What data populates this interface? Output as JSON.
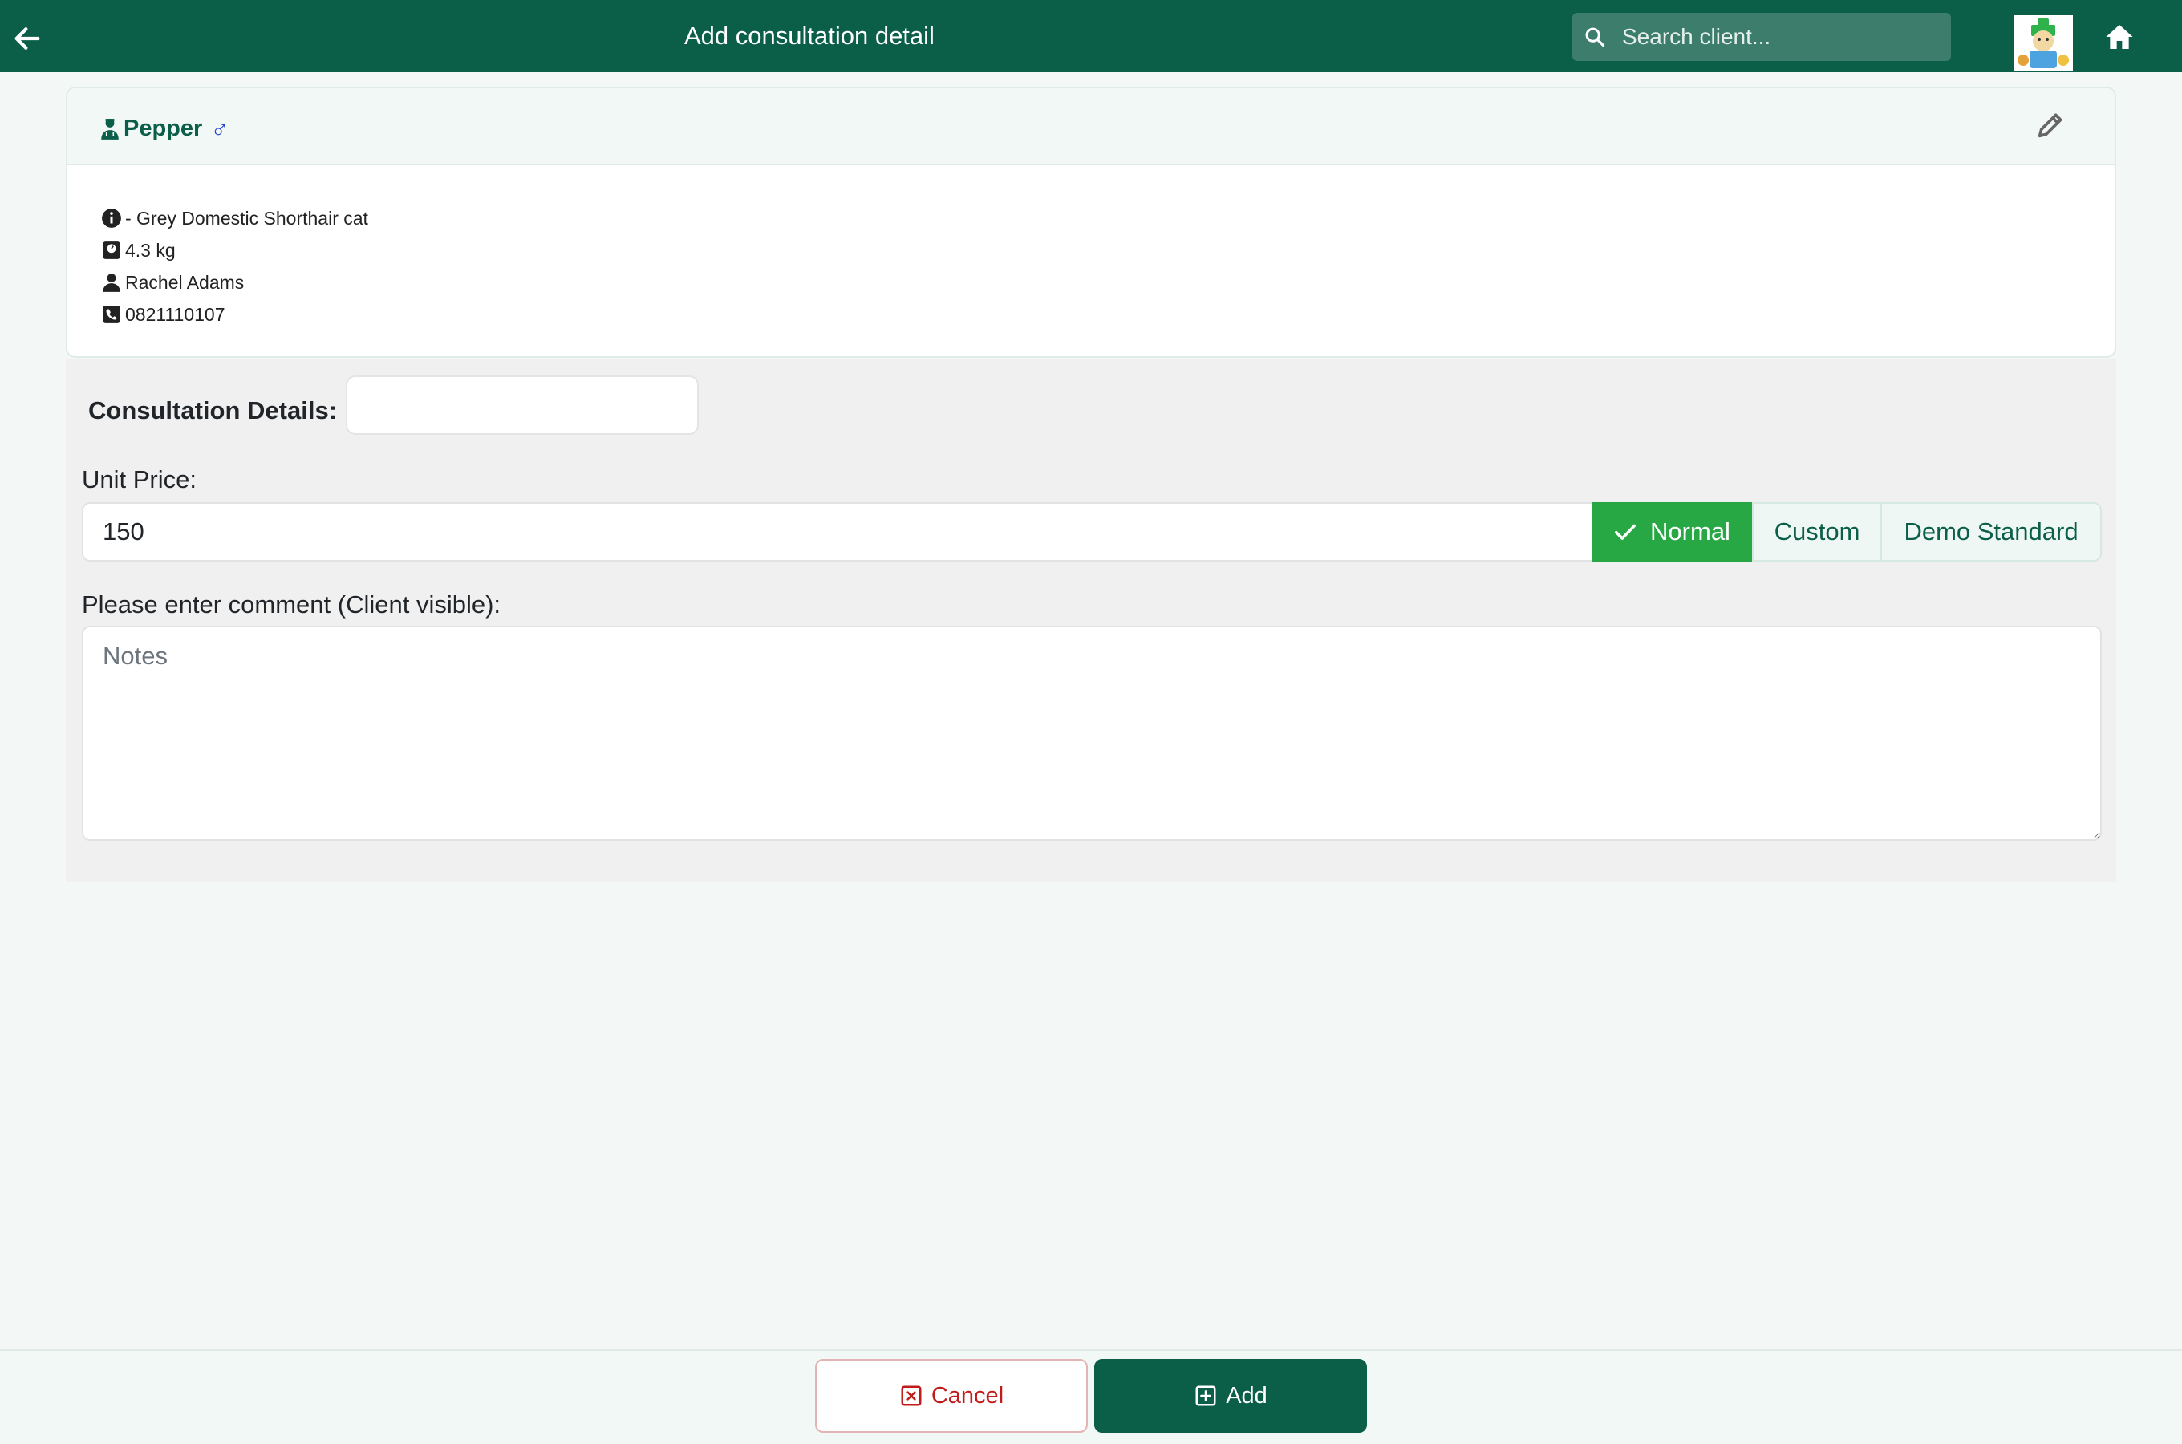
{
  "header": {
    "title": "Add consultation detail",
    "search_placeholder": "Search client..."
  },
  "patient": {
    "name": "Pepper",
    "sex_symbol": "♂",
    "description": "- Grey Domestic Shorthair cat",
    "weight": "4.3 kg",
    "owner": "Rachel Adams",
    "phone": "0821110107"
  },
  "form": {
    "consultation_label": "Consultation Details:",
    "unit_price_label": "Unit Price:",
    "unit_price_value": "150",
    "price_options": [
      "Normal",
      "Custom",
      "Demo Standard"
    ],
    "selected_price_option": "Normal",
    "comment_label": "Please enter comment (Client visible):",
    "notes_placeholder": "Notes"
  },
  "footer": {
    "cancel_label": "Cancel",
    "add_label": "Add"
  },
  "colors": {
    "brand": "#0b5e48",
    "selected": "#28a745",
    "cancel": "#c21b1b",
    "male": "#1f3fd2"
  },
  "icons": [
    "back-arrow-icon",
    "search-icon",
    "app-logo",
    "home-icon",
    "vet-icon",
    "male-icon",
    "pencil-icon",
    "info-icon",
    "weight-icon",
    "person-icon",
    "phone-icon",
    "check-icon",
    "x-square-icon",
    "plus-square-icon"
  ]
}
